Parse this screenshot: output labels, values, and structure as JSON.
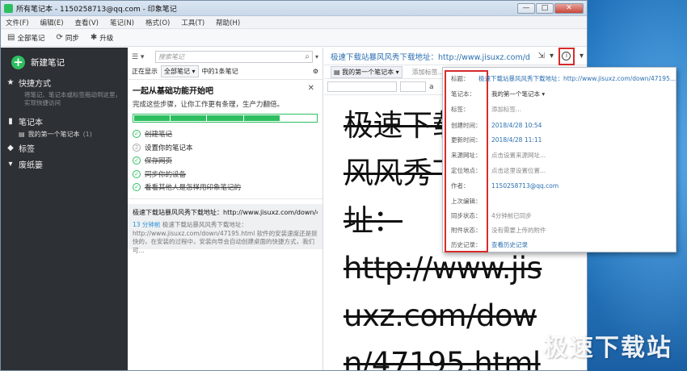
{
  "window": {
    "title": "所有笔记本 - 1150258713@qq.com - 印象笔记",
    "buttons": {
      "minimize": "—",
      "maximize": "□",
      "close": "✕"
    }
  },
  "menu": [
    "文件(F)",
    "编辑(E)",
    "查看(V)",
    "笔记(N)",
    "格式(O)",
    "工具(T)",
    "帮助(H)"
  ],
  "toolbar": {
    "all_notes": "全部笔记",
    "sync": "同步",
    "upgrade": "升级"
  },
  "sidebar": {
    "new_note": "新建笔记",
    "shortcuts": "快捷方式",
    "shortcuts_hint": "将笔记、笔记本或标签拖动到这里，实现快捷访问",
    "notebooks": "笔记本",
    "notebook_item": "我的第一个笔记本",
    "notebook_count": "(1)",
    "tags": "标签",
    "trash": "废纸篓"
  },
  "notelist": {
    "search_placeholder": "搜索笔记",
    "showing_label": "正在显示",
    "filter_value": "全部笔记",
    "count_text": "中的1条笔记",
    "get_started": {
      "title": "一起从基础功能开始吧",
      "subtitle": "完成这些步骤，让你工作更有条理，生产力翻倍。",
      "progress": 0.8,
      "steps": [
        {
          "text": "创建笔记",
          "done": true
        },
        {
          "text": "设置你的笔记本",
          "done": false
        },
        {
          "text": "保存网页",
          "done": true
        },
        {
          "text": "同步你的设备",
          "done": true
        },
        {
          "text": "看看其他人是怎样用印象笔记的",
          "done": true
        }
      ]
    },
    "note": {
      "title": "极速下载站暴风风秀下载地址：http://www.jisuxz.com/down/4719...",
      "time": "13 分钟前",
      "snippet": "极速下载站暴风风秀下载地址：http://www.jisuxz.com/down/47195.html 软件的安装速度还是挺快的，在安装的过程中，安装向导会自动创建桌面的快捷方式，我们可..."
    }
  },
  "editor": {
    "title": "极速下载站暴风风秀下载地址：http://www.jisuxz.com/d",
    "notebook": "我的第一个笔记本",
    "add_tag": "添加标签...",
    "font_a": "a",
    "lines": [
      "极速下载",
      "风风秀下",
      "址：",
      "http://www.jis",
      "uxz.com/dow",
      "n/47195.html"
    ]
  },
  "info_panel": {
    "rows": [
      {
        "label": "标题：",
        "value": "极速下载站暴风风秀下载地址：http://www.jisuxz.com/down/47195...",
        "style": "link"
      },
      {
        "label": "笔记本：",
        "value": "我的第一个笔记本 ▾",
        "style": "plain"
      },
      {
        "label": "标签：",
        "value": "添加标签...",
        "style": "grey"
      },
      {
        "label": "创建时间：",
        "value": "2018/4/28 10:54",
        "style": "link"
      },
      {
        "label": "更新时间：",
        "value": "2018/4/28 11:11",
        "style": "link"
      },
      {
        "label": "来源网址：",
        "value": "点击设置来源网址...",
        "style": "grey"
      },
      {
        "label": "定位地点：",
        "value": "点击这里设置位置...",
        "style": "grey"
      },
      {
        "label": "作者：",
        "value": "1150258713@qq.com",
        "style": "link"
      },
      {
        "label": "上次编辑：",
        "value": "",
        "style": "plain"
      },
      {
        "label": "同步状态：",
        "value": "4分钟前已同步",
        "style": "grey"
      },
      {
        "label": "附件状态：",
        "value": "没有需要上传的附件",
        "style": "grey"
      },
      {
        "label": "历史记录：",
        "value": "查看历史记录",
        "style": "link"
      }
    ]
  },
  "watermark": "极速下载站",
  "colors": {
    "accent_green": "#2dbe60",
    "link_blue": "#2b6fb0",
    "highlight_red": "#d72b2b",
    "sidebar_bg": "#2d3034"
  }
}
